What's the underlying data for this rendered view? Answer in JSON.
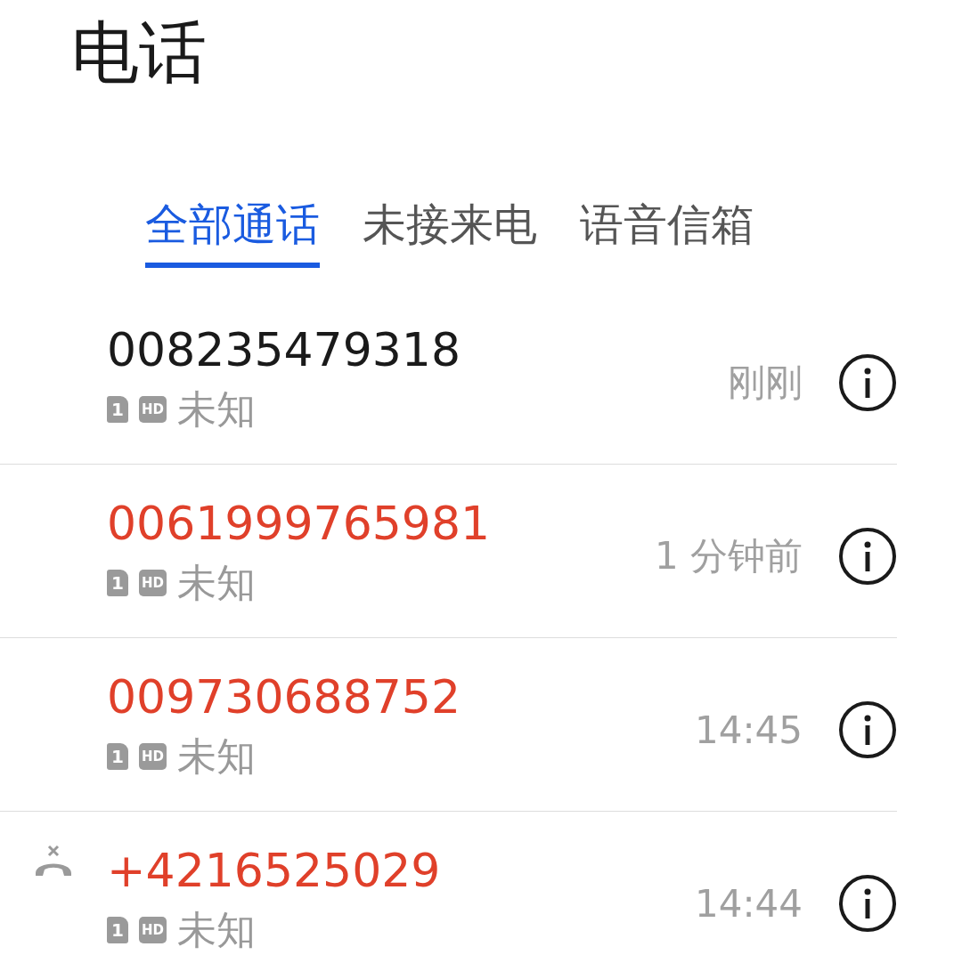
{
  "title": "电话",
  "tabs": [
    {
      "label": "全部通话",
      "selected": true
    },
    {
      "label": "未接来电",
      "selected": false
    },
    {
      "label": "语音信箱",
      "selected": false
    }
  ],
  "calls": [
    {
      "number": "008235479318",
      "missed": false,
      "rejected": false,
      "sim": "1",
      "hd": "HD",
      "location": "未知",
      "time": "刚刚"
    },
    {
      "number": "0061999765981",
      "missed": true,
      "rejected": false,
      "sim": "1",
      "hd": "HD",
      "location": "未知",
      "time": "1 分钟前"
    },
    {
      "number": "009730688752",
      "missed": true,
      "rejected": false,
      "sim": "1",
      "hd": "HD",
      "location": "未知",
      "time": "14:45"
    },
    {
      "number": "+4216525029",
      "missed": true,
      "rejected": true,
      "sim": "1",
      "hd": "HD",
      "location": "未知",
      "time": "14:44"
    }
  ]
}
